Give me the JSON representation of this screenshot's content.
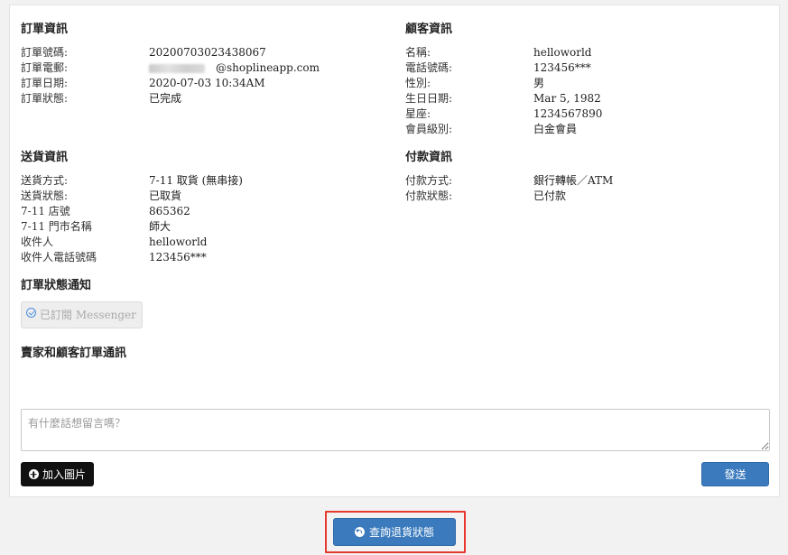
{
  "order_info": {
    "title": "訂單資訊",
    "rows": [
      {
        "label": "訂單號碼:",
        "value": "20200703023438067"
      },
      {
        "label": "訂單電郵:",
        "value": "@shoplineapp.com"
      },
      {
        "label": "訂單日期:",
        "value": "2020-07-03 10:34AM"
      },
      {
        "label": "訂單狀態:",
        "value": "已完成"
      }
    ]
  },
  "customer_info": {
    "title": "顧客資訊",
    "rows": [
      {
        "label": "名稱:",
        "value": "helloworld"
      },
      {
        "label": "電話號碼:",
        "value": "123456***"
      },
      {
        "label": "性別:",
        "value": "男"
      },
      {
        "label": "生日日期:",
        "value": "Mar 5, 1982"
      },
      {
        "label": "星座:",
        "value": "1234567890"
      },
      {
        "label": "會員級別:",
        "value": "白金會員"
      }
    ]
  },
  "delivery_info": {
    "title": "送貨資訊",
    "rows": [
      {
        "label": "送貨方式:",
        "value": "7-11 取貨 (無串接)"
      },
      {
        "label": "送貨狀態:",
        "value": "已取貨"
      },
      {
        "label": "7-11 店號",
        "value": "865362"
      },
      {
        "label": "7-11 門市名稱",
        "value": "師大"
      },
      {
        "label": "收件人",
        "value": "helloworld"
      },
      {
        "label": "收件人電話號碼",
        "value": "123456***"
      }
    ]
  },
  "payment_info": {
    "title": "付款資訊",
    "rows": [
      {
        "label": "付款方式:",
        "value": "銀行轉帳／ATM"
      },
      {
        "label": "付款狀態:",
        "value": "已付款"
      }
    ]
  },
  "notification": {
    "title": "訂單狀態通知",
    "messenger_label": "已訂閱 Messenger"
  },
  "messaging": {
    "title": "賣家和顧客訂單通訊",
    "placeholder": "有什麼話想留言嗎？",
    "add_image_label": "加入圖片",
    "send_label": "發送"
  },
  "return_status_button": "查詢退貨狀態",
  "colors": {
    "primary": "#3a7abd",
    "highlight": "#e8392e",
    "dark_button": "#111111"
  }
}
